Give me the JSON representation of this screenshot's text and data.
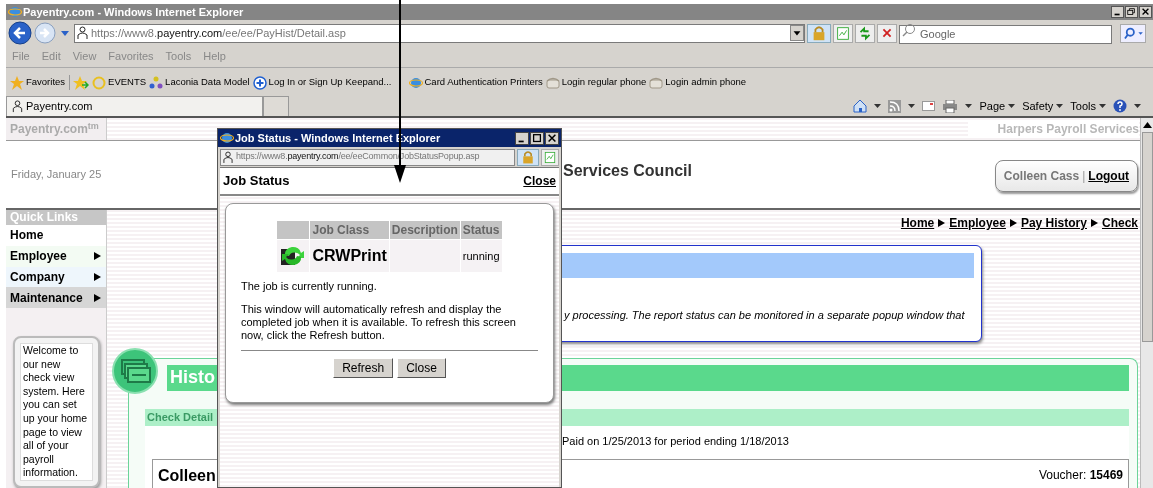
{
  "browser": {
    "title": "Payentry.com - Windows Internet Explorer",
    "address": {
      "scheme": "https://",
      "subdomain": "www8.",
      "domain": "payentry.com",
      "path": "/ee/ee/PayHist/Detail.asp"
    },
    "search": {
      "placeholder": "Google"
    },
    "menu": [
      "File",
      "Edit",
      "View",
      "Favorites",
      "Tools",
      "Help"
    ],
    "favorites_button": "Favorites",
    "favorites": [
      {
        "kind": "ring",
        "label": "EVENTS"
      },
      {
        "kind": "model",
        "label": "Laconia Data Model"
      },
      {
        "kind": "plus",
        "label": "Log In or Sign Up"
      },
      {
        "kind": "plain",
        "label": "Keepand..."
      },
      {
        "kind": "ie",
        "label": "Card Authentication Printers"
      },
      {
        "kind": "phone",
        "label": "Login regular phone"
      },
      {
        "kind": "phone",
        "label": "Login admin phone"
      }
    ],
    "tab": "Payentry.com",
    "commands": [
      "Page",
      "Safety",
      "Tools"
    ]
  },
  "page": {
    "brand": "Payentry.com$^{tm}$",
    "company": "Harpers Payroll Services",
    "date": "Friday, January 25",
    "org_title": "Services Council",
    "user": {
      "name": "Colleen Cass",
      "separator": "|",
      "logout": "Logout"
    },
    "quick_links_title": "Quick Links",
    "nav": [
      {
        "label": "Home",
        "submenu": false,
        "color": "#ffffff"
      },
      {
        "label": "Employee",
        "submenu": true,
        "color": "#f3fbf3"
      },
      {
        "label": "Company",
        "submenu": true,
        "color": "#eef6fc"
      },
      {
        "label": "Maintenance",
        "submenu": true,
        "color": "#d6d6d6"
      }
    ],
    "welcome": "Welcome to our new check view system. Here you can set up your home page to view all of your payroll information.",
    "breadcrumb": [
      "Home",
      "Employee",
      "Pay History",
      "Check"
    ],
    "notice": "y processing. The report status can be monitored in a separate popup window that",
    "history": {
      "title": "Histo",
      "section": "Check Detail",
      "paid_line": "Paid on 1/25/2013 for period ending 1/18/2013",
      "employee": "Colleen",
      "voucher_label": "Voucher:",
      "voucher": "15469"
    }
  },
  "popup": {
    "title": "Job Status - Windows Internet Explorer",
    "address": {
      "scheme": "https://",
      "subdomain": "www8.",
      "domain": "payentry.com",
      "path": "/ee/eeCommon/JobStatusPopup.asp"
    },
    "heading": "Job Status",
    "close_link": "Close",
    "table": {
      "columns": [
        "Job Class",
        "Description",
        "Status"
      ],
      "rows": [
        {
          "job_class": "CRWPrint",
          "status": "running"
        }
      ]
    },
    "message": "The job is currently running.",
    "detail": "This window will automatically refresh and display the completed job when it is available. To refresh this screen now, click the Refresh button.",
    "buttons": [
      "Refresh",
      "Close"
    ]
  }
}
